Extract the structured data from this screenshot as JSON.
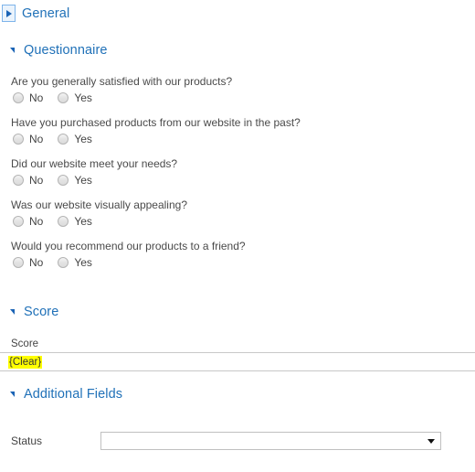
{
  "sections": {
    "general": {
      "title": "General",
      "expanded": false,
      "icon": "triangle-right-icon"
    },
    "questionnaire": {
      "title": "Questionnaire",
      "expanded": true,
      "icon": "triangle-down-icon"
    },
    "score": {
      "title": "Score",
      "expanded": true,
      "icon": "triangle-down-icon"
    },
    "additional": {
      "title": "Additional Fields",
      "expanded": true,
      "icon": "triangle-down-icon"
    }
  },
  "questionnaire": {
    "options": {
      "no": "No",
      "yes": "Yes"
    },
    "questions": [
      {
        "text": "Are you generally satisfied with our products?",
        "selected": ""
      },
      {
        "text": "Have you purchased products from our website in the past?",
        "selected": ""
      },
      {
        "text": "Did our website meet your needs?",
        "selected": ""
      },
      {
        "text": "Was our website visually appealing?",
        "selected": ""
      },
      {
        "text": "Would you recommend our products to a friend?",
        "selected": ""
      }
    ]
  },
  "score": {
    "label": "Score",
    "value": "{Clear}",
    "highlight_color": "#ffff00"
  },
  "additional_fields": {
    "status": {
      "label": "Status",
      "value": "",
      "placeholder": "",
      "caret_icon": "caret-down-icon"
    }
  },
  "colors": {
    "header_blue": "#2071b8",
    "triangle_blue": "#1a63b5",
    "focus_border": "#7eb4ea",
    "text": "#444444"
  }
}
